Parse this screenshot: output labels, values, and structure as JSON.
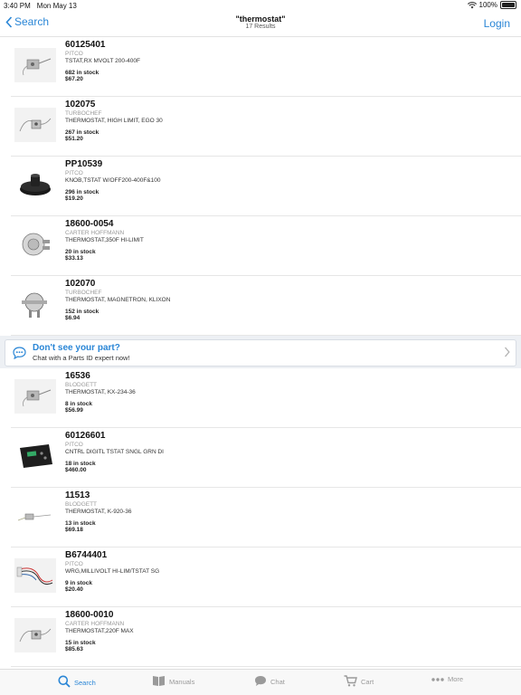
{
  "status_bar": {
    "time": "3:40 PM",
    "date": "Mon May 13",
    "battery": "100%"
  },
  "nav": {
    "back_label": "Search",
    "title": "\"thermostat\"",
    "subtitle": "17 Results",
    "login_label": "Login"
  },
  "results": [
    {
      "part": "60125401",
      "mfr": "PITCO",
      "desc": "TSTAT,RX MVOLT 200-400F",
      "stock": "682 in stock",
      "price": "$67.20",
      "thumb": "probe-thermostat"
    },
    {
      "part": "102075",
      "mfr": "TURBOCHEF",
      "desc": "THERMOSTAT, HIGH LIMIT, EGO 30",
      "stock": "267 in stock",
      "price": "$51.20",
      "thumb": "capillary-thermostat"
    },
    {
      "part": "PP10539",
      "mfr": "PITCO",
      "desc": "KNOB,TSTAT W/OFF200-400F&100",
      "stock": "296 in stock",
      "price": "$19.20",
      "thumb": "black-knob"
    },
    {
      "part": "18600-0054",
      "mfr": "CARTER HOFFMANN",
      "desc": "THERMOSTAT,350F HI-LIMIT",
      "stock": "20 in stock",
      "price": "$33.13",
      "thumb": "round-thermostat"
    },
    {
      "part": "102070",
      "mfr": "TURBOCHEF",
      "desc": "THERMOSTAT, MAGNETRON, KLIXON",
      "stock": "152 in stock",
      "price": "$6.94",
      "thumb": "disc-thermostat"
    }
  ],
  "chat_banner": {
    "heading": "Don't see your part?",
    "subtext": "Chat with a Parts ID expert now!"
  },
  "results_more": [
    {
      "part": "16536",
      "mfr": "BLODGETT",
      "desc": "THERMOSTAT, KX-234-36",
      "stock": "8 in stock",
      "price": "$56.99",
      "thumb": "probe-thermostat"
    },
    {
      "part": "60126601",
      "mfr": "PITCO",
      "desc": "CNTRL DIGITL TSTAT SNGL GRN DI",
      "stock": "18 in stock",
      "price": "$460.00",
      "thumb": "digital-control"
    },
    {
      "part": "11513",
      "mfr": "BLODGETT",
      "desc": "THERMOSTAT, K-920-36",
      "stock": "13 in stock",
      "price": "$69.18",
      "thumb": "small-probe"
    },
    {
      "part": "B6744401",
      "mfr": "PITCO",
      "desc": "WRG,MILLIVOLT HI-LIM/TSTAT SG",
      "stock": "9 in stock",
      "price": "$20.40",
      "thumb": "wiring-harness"
    },
    {
      "part": "18600-0010",
      "mfr": "CARTER HOFFMANN",
      "desc": "THERMOSTAT,220F MAX",
      "stock": "15 in stock",
      "price": "$85.63",
      "thumb": "capillary-thermostat"
    }
  ],
  "tabs": [
    {
      "label": "Search",
      "icon": "search-icon",
      "active": true
    },
    {
      "label": "Manuals",
      "icon": "book-icon",
      "active": false
    },
    {
      "label": "Chat",
      "icon": "chat-bubble-icon",
      "active": false
    },
    {
      "label": "Cart",
      "icon": "cart-icon",
      "active": false
    },
    {
      "label": "More",
      "icon": "more-dots-icon",
      "active": false
    }
  ],
  "colors": {
    "accent": "#2a86d6",
    "inactive": "#9a9a9a",
    "banner_bg": "#edf0f4"
  }
}
